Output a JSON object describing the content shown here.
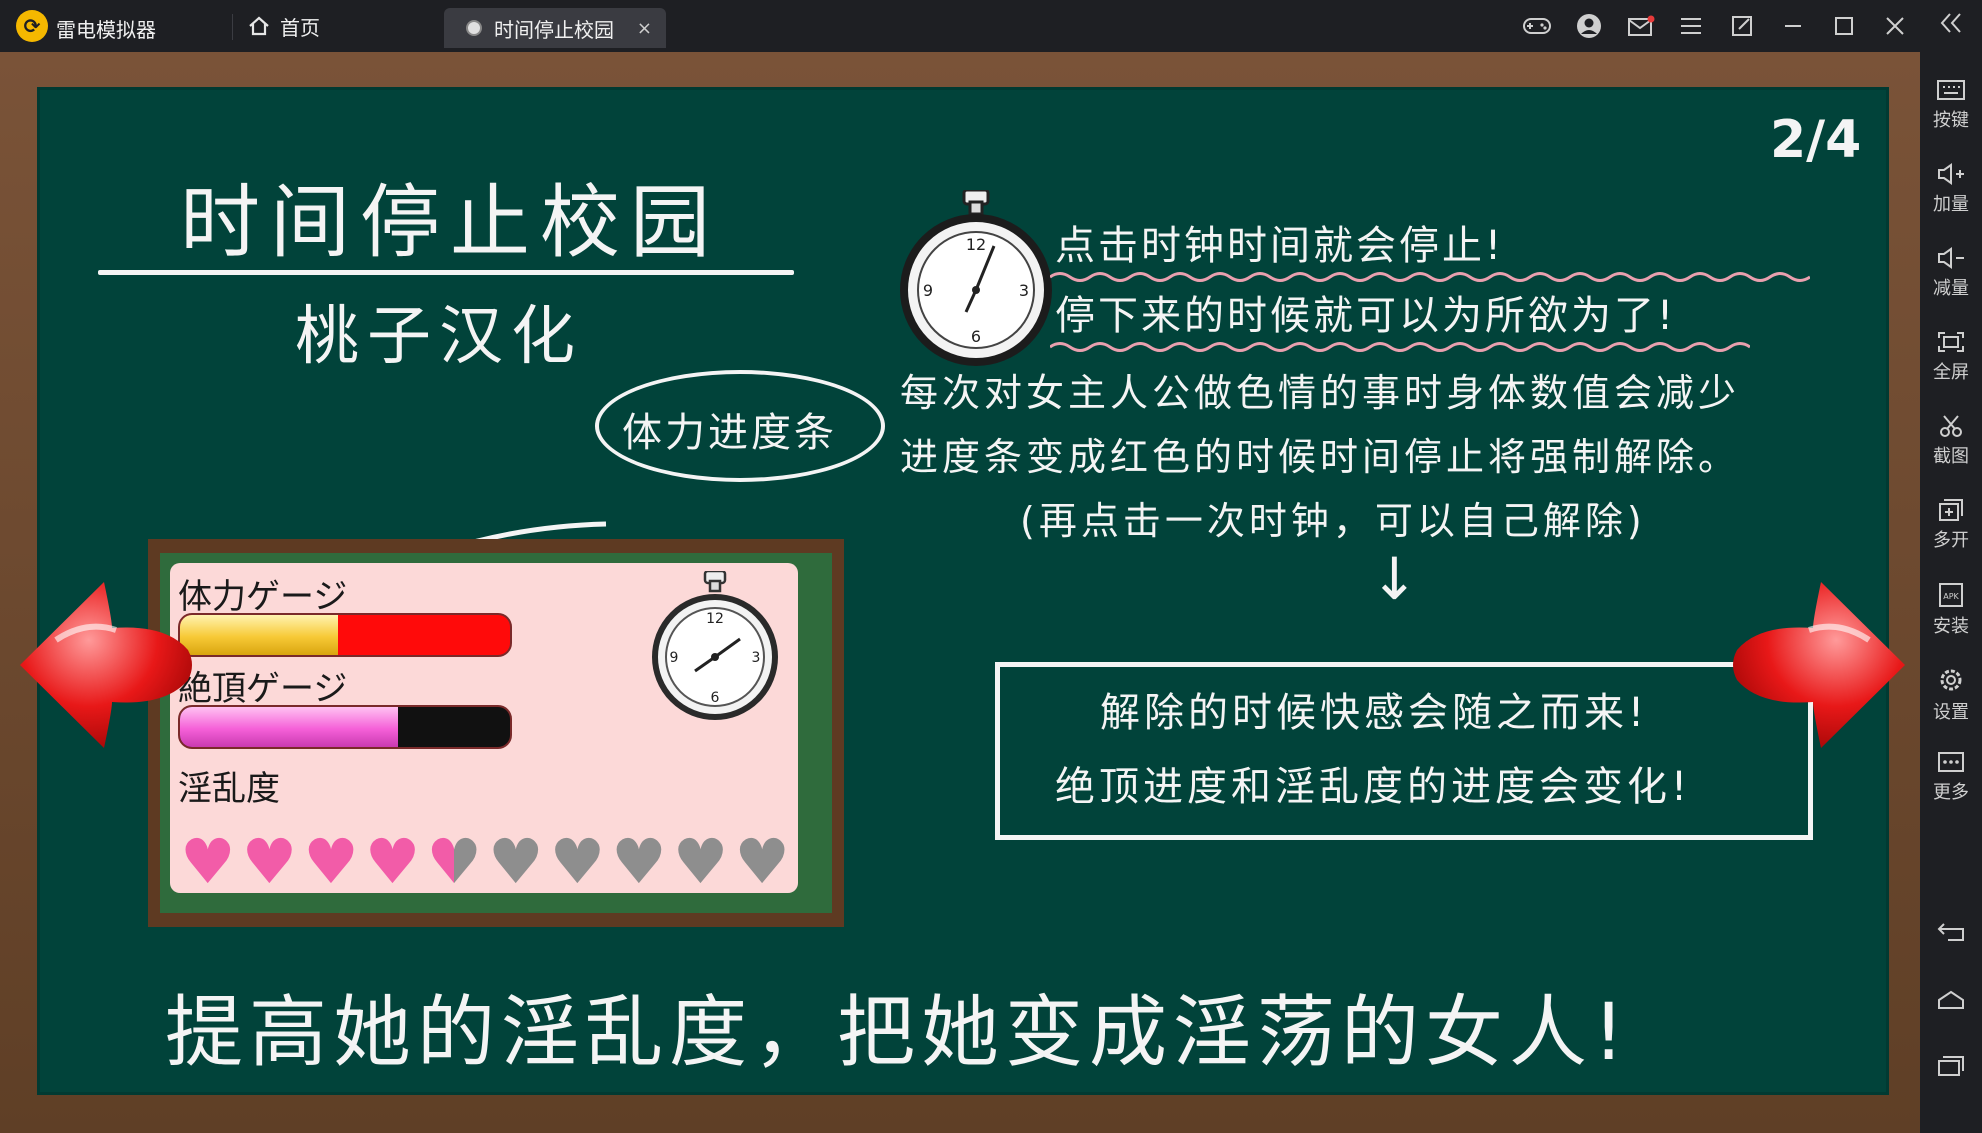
{
  "window": {
    "app_title": "雷电模拟器",
    "logo_glyph": "⟳"
  },
  "tabs": [
    {
      "label": "首页"
    },
    {
      "label": "时间停止校园",
      "close": "×"
    }
  ],
  "sidebar": [
    {
      "label": "按键",
      "icon": "keyboard-icon"
    },
    {
      "label": "加量",
      "icon": "volume-up-icon"
    },
    {
      "label": "减量",
      "icon": "volume-down-icon"
    },
    {
      "label": "全屏",
      "icon": "fullscreen-icon"
    },
    {
      "label": "截图",
      "icon": "scissors-icon"
    },
    {
      "label": "多开",
      "icon": "multi-instance-icon"
    },
    {
      "label": "安装",
      "icon": "apk-icon"
    },
    {
      "label": "设置",
      "icon": "settings-icon"
    },
    {
      "label": "更多",
      "icon": "more-icon"
    }
  ],
  "game": {
    "page_counter": "2/4",
    "title": "时间停止校园",
    "translator": "桃子汉化",
    "stop_line_1": "点击时钟时间就会停止!",
    "stop_line_2": "停下来的时候就可以为所欲为了!",
    "gauge_label": "体力进度条",
    "desc_line_1": "每次对女主人公做色情的事时身体数值会减少",
    "desc_line_2": "进度条变成红色的时候时间停止将强制解除。",
    "desc_line_3": "(再点击一次时钟，可以自己解除)",
    "down_arrow": "↓",
    "effect_line_1": "解除的时候快感会随之而来!",
    "effect_line_2": "绝顶进度和淫乱度的进度会变化!",
    "slogan": "提高她的淫乱度，把她变成淫荡的女人!",
    "mini": {
      "stamina_label": "体力ゲージ",
      "stamina_level": 0.48,
      "climax_label": "絶頂ゲージ",
      "climax_level": 0.66,
      "lewdness_label": "淫乱度",
      "hearts_total": 10,
      "hearts_filled": 4.5
    },
    "colors": {
      "board": "#01433a",
      "chalk": "#f4f4f4",
      "stamina_yellow": "#f7c936",
      "stamina_red": "#ff0a0a",
      "climax_pink": "#f560d8",
      "heart_pink": "#f25ca8",
      "heart_grey": "#8e8e8e",
      "arrow_red": "#e81818"
    }
  }
}
